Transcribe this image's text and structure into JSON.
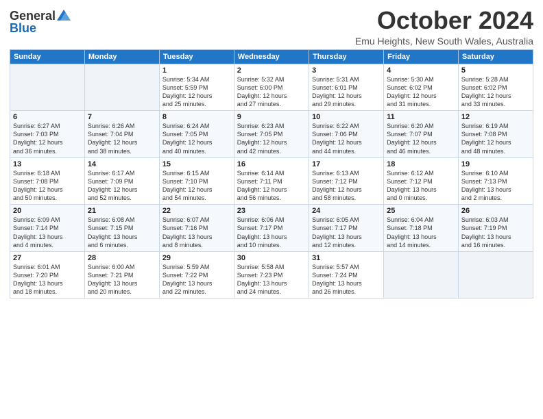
{
  "logo": {
    "general": "General",
    "blue": "Blue"
  },
  "header": {
    "month_year": "October 2024",
    "location": "Emu Heights, New South Wales, Australia"
  },
  "days_of_week": [
    "Sunday",
    "Monday",
    "Tuesday",
    "Wednesday",
    "Thursday",
    "Friday",
    "Saturday"
  ],
  "weeks": [
    [
      {
        "day": "",
        "content": ""
      },
      {
        "day": "",
        "content": ""
      },
      {
        "day": "1",
        "content": "Sunrise: 5:34 AM\nSunset: 5:59 PM\nDaylight: 12 hours\nand 25 minutes."
      },
      {
        "day": "2",
        "content": "Sunrise: 5:32 AM\nSunset: 6:00 PM\nDaylight: 12 hours\nand 27 minutes."
      },
      {
        "day": "3",
        "content": "Sunrise: 5:31 AM\nSunset: 6:01 PM\nDaylight: 12 hours\nand 29 minutes."
      },
      {
        "day": "4",
        "content": "Sunrise: 5:30 AM\nSunset: 6:02 PM\nDaylight: 12 hours\nand 31 minutes."
      },
      {
        "day": "5",
        "content": "Sunrise: 5:28 AM\nSunset: 6:02 PM\nDaylight: 12 hours\nand 33 minutes."
      }
    ],
    [
      {
        "day": "6",
        "content": "Sunrise: 6:27 AM\nSunset: 7:03 PM\nDaylight: 12 hours\nand 36 minutes."
      },
      {
        "day": "7",
        "content": "Sunrise: 6:26 AM\nSunset: 7:04 PM\nDaylight: 12 hours\nand 38 minutes."
      },
      {
        "day": "8",
        "content": "Sunrise: 6:24 AM\nSunset: 7:05 PM\nDaylight: 12 hours\nand 40 minutes."
      },
      {
        "day": "9",
        "content": "Sunrise: 6:23 AM\nSunset: 7:05 PM\nDaylight: 12 hours\nand 42 minutes."
      },
      {
        "day": "10",
        "content": "Sunrise: 6:22 AM\nSunset: 7:06 PM\nDaylight: 12 hours\nand 44 minutes."
      },
      {
        "day": "11",
        "content": "Sunrise: 6:20 AM\nSunset: 7:07 PM\nDaylight: 12 hours\nand 46 minutes."
      },
      {
        "day": "12",
        "content": "Sunrise: 6:19 AM\nSunset: 7:08 PM\nDaylight: 12 hours\nand 48 minutes."
      }
    ],
    [
      {
        "day": "13",
        "content": "Sunrise: 6:18 AM\nSunset: 7:08 PM\nDaylight: 12 hours\nand 50 minutes."
      },
      {
        "day": "14",
        "content": "Sunrise: 6:17 AM\nSunset: 7:09 PM\nDaylight: 12 hours\nand 52 minutes."
      },
      {
        "day": "15",
        "content": "Sunrise: 6:15 AM\nSunset: 7:10 PM\nDaylight: 12 hours\nand 54 minutes."
      },
      {
        "day": "16",
        "content": "Sunrise: 6:14 AM\nSunset: 7:11 PM\nDaylight: 12 hours\nand 56 minutes."
      },
      {
        "day": "17",
        "content": "Sunrise: 6:13 AM\nSunset: 7:12 PM\nDaylight: 12 hours\nand 58 minutes."
      },
      {
        "day": "18",
        "content": "Sunrise: 6:12 AM\nSunset: 7:12 PM\nDaylight: 13 hours\nand 0 minutes."
      },
      {
        "day": "19",
        "content": "Sunrise: 6:10 AM\nSunset: 7:13 PM\nDaylight: 13 hours\nand 2 minutes."
      }
    ],
    [
      {
        "day": "20",
        "content": "Sunrise: 6:09 AM\nSunset: 7:14 PM\nDaylight: 13 hours\nand 4 minutes."
      },
      {
        "day": "21",
        "content": "Sunrise: 6:08 AM\nSunset: 7:15 PM\nDaylight: 13 hours\nand 6 minutes."
      },
      {
        "day": "22",
        "content": "Sunrise: 6:07 AM\nSunset: 7:16 PM\nDaylight: 13 hours\nand 8 minutes."
      },
      {
        "day": "23",
        "content": "Sunrise: 6:06 AM\nSunset: 7:17 PM\nDaylight: 13 hours\nand 10 minutes."
      },
      {
        "day": "24",
        "content": "Sunrise: 6:05 AM\nSunset: 7:17 PM\nDaylight: 13 hours\nand 12 minutes."
      },
      {
        "day": "25",
        "content": "Sunrise: 6:04 AM\nSunset: 7:18 PM\nDaylight: 13 hours\nand 14 minutes."
      },
      {
        "day": "26",
        "content": "Sunrise: 6:03 AM\nSunset: 7:19 PM\nDaylight: 13 hours\nand 16 minutes."
      }
    ],
    [
      {
        "day": "27",
        "content": "Sunrise: 6:01 AM\nSunset: 7:20 PM\nDaylight: 13 hours\nand 18 minutes."
      },
      {
        "day": "28",
        "content": "Sunrise: 6:00 AM\nSunset: 7:21 PM\nDaylight: 13 hours\nand 20 minutes."
      },
      {
        "day": "29",
        "content": "Sunrise: 5:59 AM\nSunset: 7:22 PM\nDaylight: 13 hours\nand 22 minutes."
      },
      {
        "day": "30",
        "content": "Sunrise: 5:58 AM\nSunset: 7:23 PM\nDaylight: 13 hours\nand 24 minutes."
      },
      {
        "day": "31",
        "content": "Sunrise: 5:57 AM\nSunset: 7:24 PM\nDaylight: 13 hours\nand 26 minutes."
      },
      {
        "day": "",
        "content": ""
      },
      {
        "day": "",
        "content": ""
      }
    ]
  ]
}
